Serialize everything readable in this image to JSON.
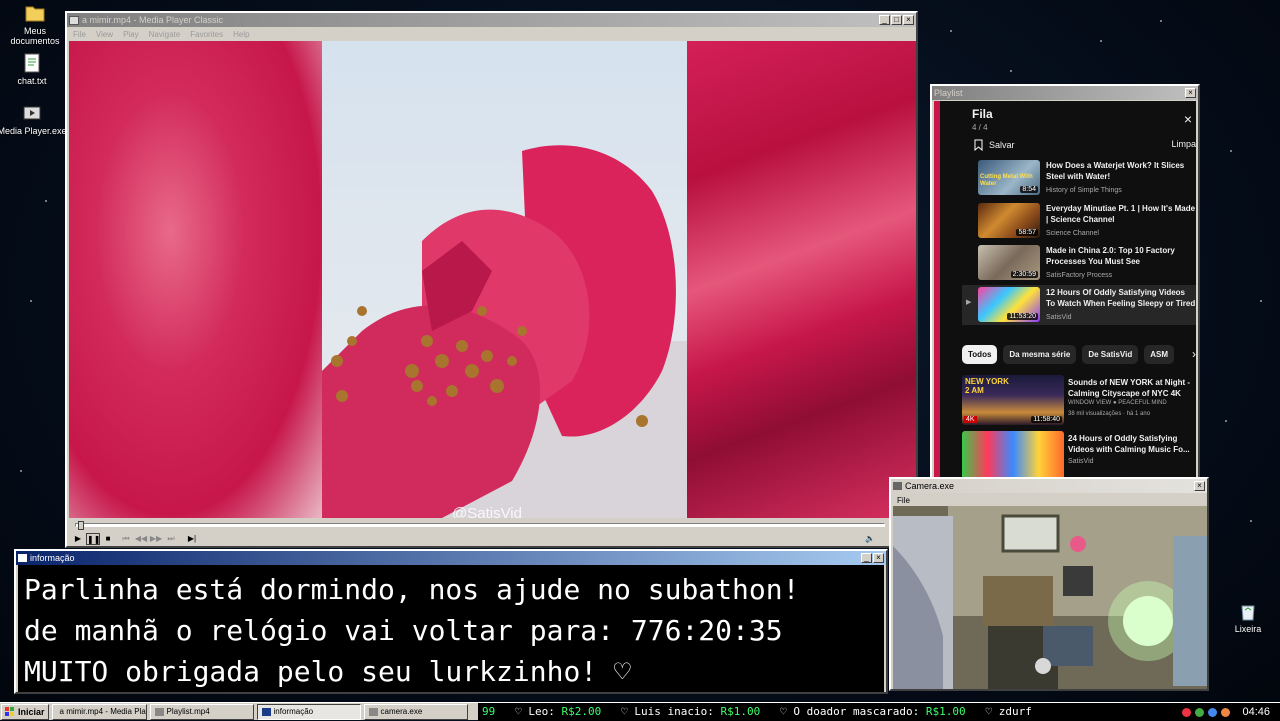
{
  "desktop": {
    "icons": [
      {
        "label": "Meus documentos",
        "icon": "folder-icon"
      },
      {
        "label": "chat.txt",
        "icon": "text-file-icon"
      },
      {
        "label": "Media Player.exe",
        "icon": "media-player-icon"
      },
      {
        "label": "Lixeira",
        "icon": "recycle-bin-icon"
      }
    ]
  },
  "media_player": {
    "title": "a mimir.mp4 - Media Player Classic",
    "menu": [
      "File",
      "View",
      "Play",
      "Navigate",
      "Favorites",
      "Help"
    ],
    "watermark": "@SatisVid",
    "progress": 0.003
  },
  "playlist": {
    "title": "Playlist",
    "queue_title": "Fila",
    "queue_count": "4 / 4",
    "save_label": "Salvar",
    "clear_label": "Limpa",
    "items": [
      {
        "title": "How Does a Waterjet Work? It Slices Steel with Water!",
        "channel": "History of Simple Things",
        "duration": "8:54",
        "thumb_text": "Cutting Metal With Water"
      },
      {
        "title": "Everyday Minutiae Pt. 1 | How It's Made | Science Channel",
        "channel": "Science Channel",
        "duration": "58:57"
      },
      {
        "title": "Made in China 2.0: Top 10 Factory Processes You Must See",
        "channel": "SatisFactory Process",
        "duration": "2:30:59"
      },
      {
        "title": "12 Hours Of Oddly Satisfying Videos To Watch When Feeling Sleepy or Tired",
        "channel": "SatisVid",
        "duration": "11:53:20"
      }
    ],
    "chips": [
      "Todos",
      "Da mesma série",
      "De SatisVid",
      "ASM"
    ],
    "recommended": [
      {
        "title": "Sounds of NEW YORK at Night - Calming Cityscape of NYC 4K",
        "channel": "WINDOW VIEW ● PEACEFUL MIND",
        "meta": "38 mil visualizações · há 1 ano",
        "duration": "11:58:40",
        "thumb_text": "NEW YORK 2 AM",
        "badge": "4K"
      },
      {
        "title": "24 Hours of Oddly Satisfying Videos with Calming Music Fo...",
        "channel": "SatisVid"
      }
    ]
  },
  "info": {
    "title": "informação",
    "lines": [
      "Parlinha está dormindo, nos ajude no subathon!",
      "de manhã o relógio vai voltar para:  776:20:35",
      "MUITO obrigada pelo seu lurkzinho! ♡"
    ]
  },
  "camera": {
    "title": "Camera.exe",
    "menu_file": "File"
  },
  "taskbar": {
    "start_label": "Iniciar",
    "tasks": [
      {
        "label": "a mimir.mp4 - Media Playe...",
        "pressed": false
      },
      {
        "label": "Playlist.mp4",
        "pressed": false
      },
      {
        "label": "informação",
        "pressed": true
      },
      {
        "label": "camera.exe",
        "pressed": false
      }
    ],
    "ticker": {
      "lead": "99",
      "entries": [
        {
          "name": "Leo:",
          "amount": "R$2.00"
        },
        {
          "name": "Luis inacio:",
          "amount": "R$1.00"
        },
        {
          "name": "O doador mascarado:",
          "amount": "R$1.00"
        },
        {
          "name": "zdurf",
          "amount": ""
        }
      ]
    },
    "clock": "04:46"
  },
  "colors": {
    "title_active": "#0a246a",
    "video_pink": "#c7174a",
    "ticker_amount": "#3cff6c"
  }
}
